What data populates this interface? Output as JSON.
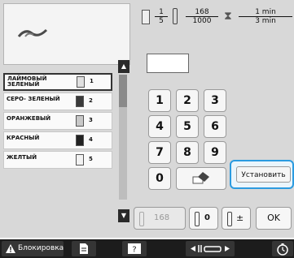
{
  "header": {
    "color_change": {
      "current": "1",
      "total": "5"
    },
    "stitches": {
      "current": "168",
      "total": "1000"
    },
    "time": {
      "current": "1 min",
      "total": "3 min"
    }
  },
  "colors": [
    {
      "name": "ЛАЙМОВЫЙ ЗЕЛЕНЫЙ",
      "number": "1",
      "swatch": "#e0e0e0",
      "selected": true
    },
    {
      "name": "СЕРО- ЗЕЛЕНЫЙ",
      "number": "2",
      "swatch": "#3a3a3a"
    },
    {
      "name": "ОРАНЖЕВЫЙ",
      "number": "3",
      "swatch": "#c8c8c8"
    },
    {
      "name": "КРАСНЫЙ",
      "number": "4",
      "swatch": "#222222"
    },
    {
      "name": "ЖЕЛТЫЙ",
      "number": "5",
      "swatch": "#f2f2f2"
    }
  ],
  "keypad": {
    "keys": [
      "1",
      "2",
      "3",
      "4",
      "5",
      "6",
      "7",
      "8",
      "9",
      "0"
    ]
  },
  "set_button": {
    "label": "Установить"
  },
  "bottom": {
    "stitch_back_value": "168",
    "needle_zero_value": "0",
    "ok_label": "OK"
  },
  "footer": {
    "lock_label": "Блокировка"
  },
  "accent_color": "#2b9be0"
}
